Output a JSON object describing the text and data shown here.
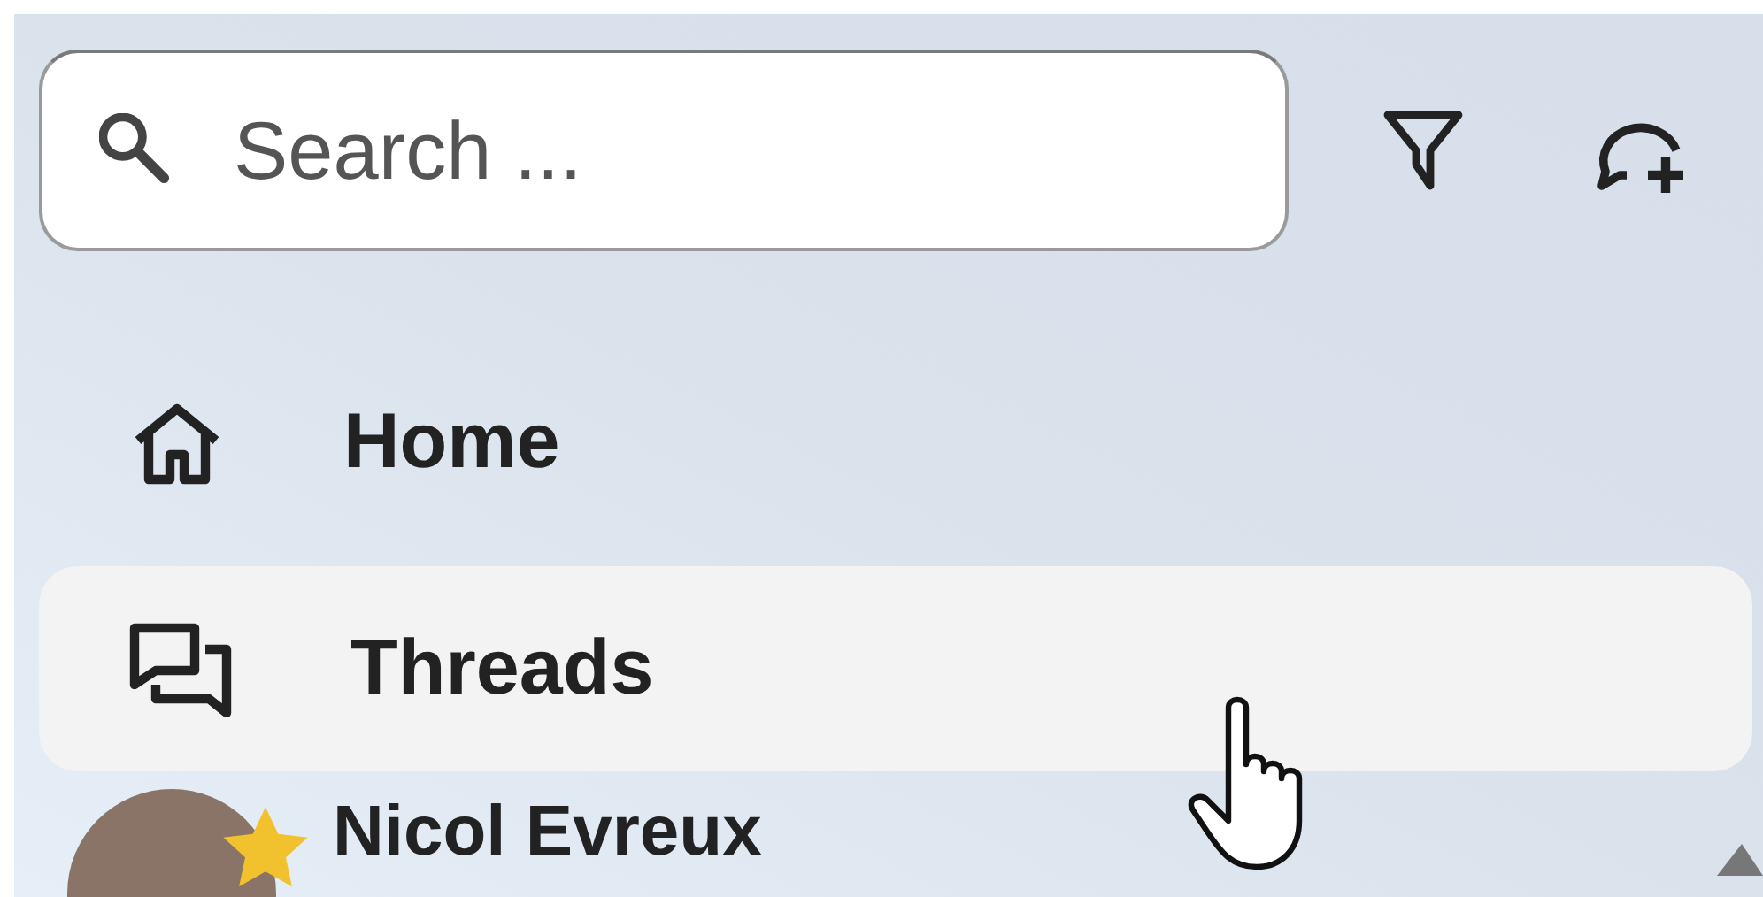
{
  "search": {
    "placeholder": "Search ..."
  },
  "nav": [
    {
      "label": "Home",
      "kind": "home",
      "selected": false
    },
    {
      "label": "Threads",
      "kind": "threads",
      "selected": true
    }
  ],
  "contacts": [
    {
      "name": "Nicol Evreux",
      "starred": true
    }
  ]
}
